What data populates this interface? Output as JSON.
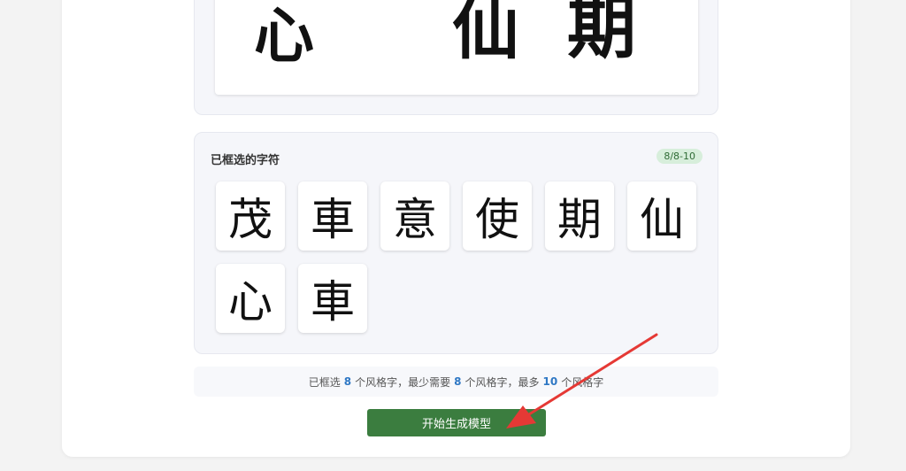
{
  "preview": {
    "glyphs": [
      "心",
      "仙",
      "期"
    ]
  },
  "selected": {
    "title": "已框选的字符",
    "count_badge": "8/8-10",
    "characters": [
      "茂",
      "車",
      "意",
      "使",
      "期",
      "仙",
      "心",
      "車"
    ]
  },
  "info": {
    "prefix": "已框选",
    "selected_count": "8",
    "mid1": "个风格字，最少需要",
    "min_count": "8",
    "mid2": "个风格字，最多",
    "max_count": "10",
    "suffix": "个风格字"
  },
  "actions": {
    "start_label": "开始生成模型"
  },
  "colors": {
    "accent_green": "#3b7d3f",
    "badge_bg": "#d7eedb",
    "number_blue": "#2f78c4",
    "arrow_red": "#e53935"
  }
}
